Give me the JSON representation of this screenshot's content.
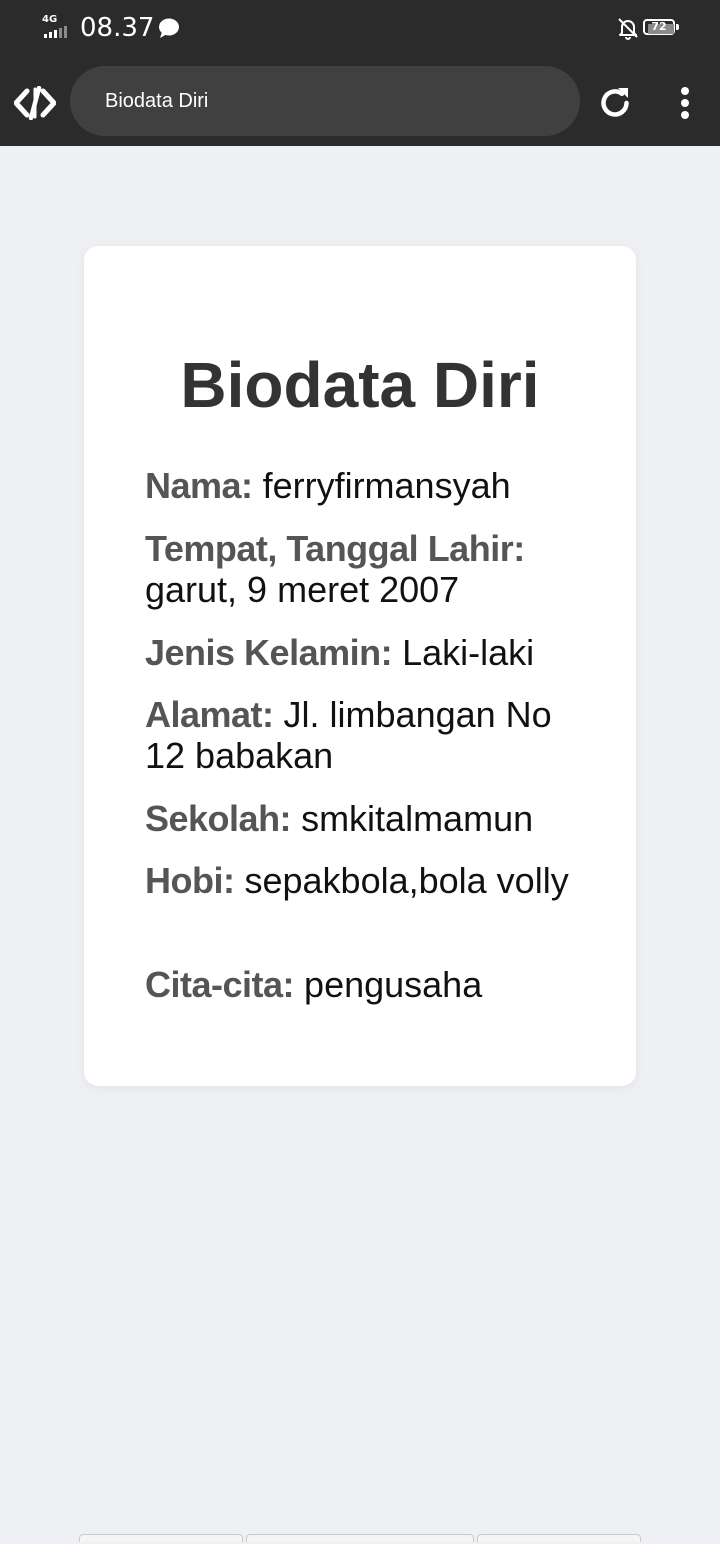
{
  "status_bar": {
    "network": "4G",
    "time": "08.37",
    "battery_level": "72"
  },
  "browser": {
    "url_text": "Biodata Diri"
  },
  "page": {
    "title": "Biodata Diri",
    "fields": [
      {
        "label": "Nama:",
        "value": "ferryfirmansyah"
      },
      {
        "label": "Tempat, Tanggal Lahir:",
        "value": "garut, 9 meret 2007"
      },
      {
        "label": "Jenis Kelamin:",
        "value": "Laki-laki"
      },
      {
        "label": "Alamat:",
        "value": "Jl. limbangan No 12 babakan"
      },
      {
        "label": "Sekolah:",
        "value": "smkitalmamun"
      },
      {
        "label": "Hobi:",
        "value": "sepakbola,bola volly"
      },
      {
        "label": "Cita-cita:",
        "value": "pengusaha"
      }
    ]
  },
  "colors": {
    "status_bar_bg": "#2b2b2b",
    "url_bar_bg": "#404040",
    "page_bg": "#eff0f4",
    "card_bg": "#ffffff",
    "title_text": "#333333",
    "label_text": "#555555",
    "value_text": "#111111"
  },
  "icons": {
    "chat": "chat-bubble-icon",
    "bell_off": "bell-off-icon",
    "logo": "code-brackets-logo-icon",
    "reload": "reload-icon",
    "menu": "more-vertical-icon"
  }
}
